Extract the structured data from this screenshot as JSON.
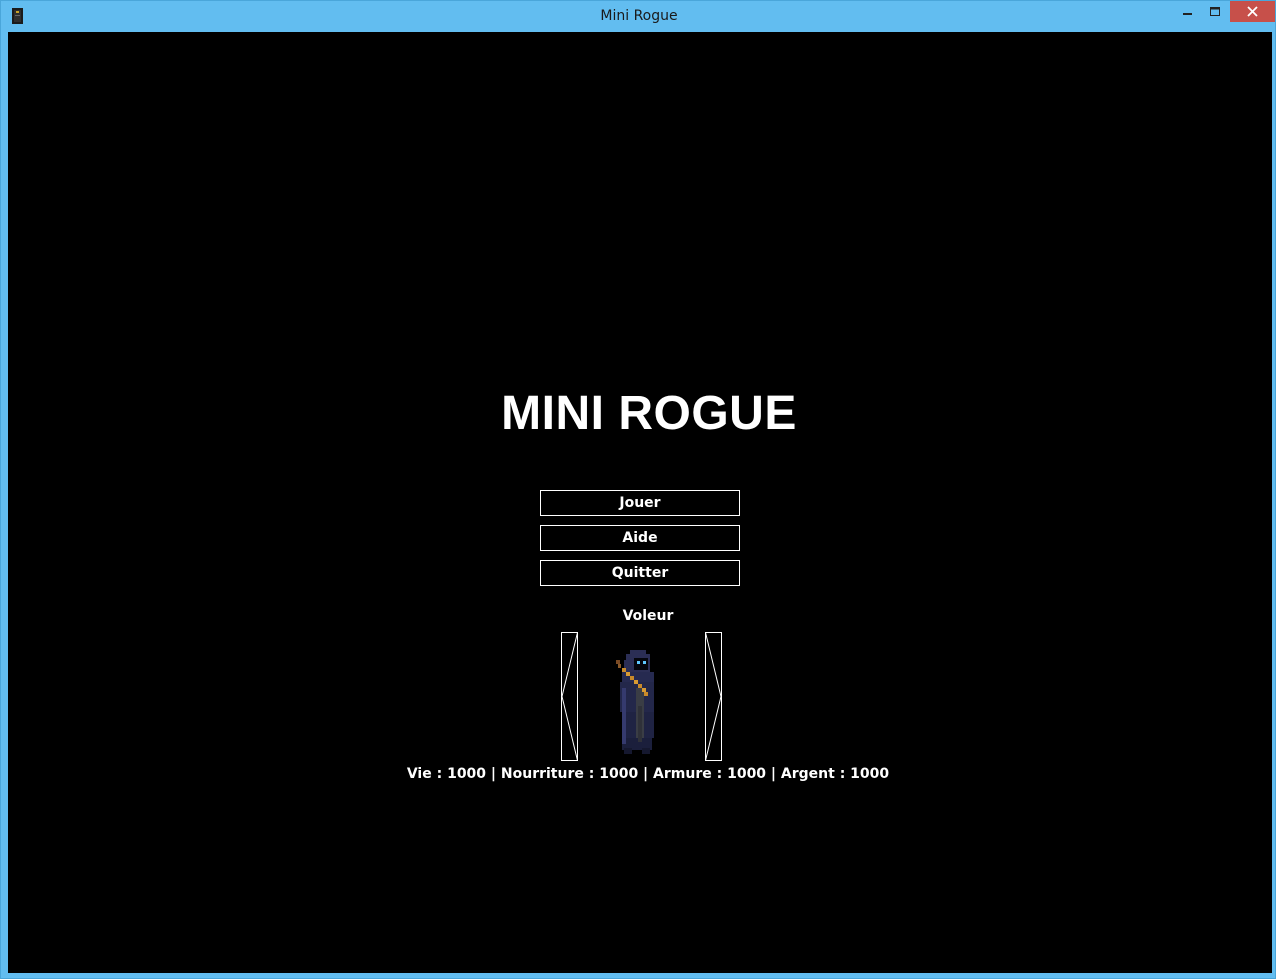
{
  "window": {
    "title": "Mini Rogue",
    "icons": [
      "app-icon",
      "minimize-icon",
      "maximize-icon",
      "close-icon"
    ]
  },
  "game": {
    "title": "MINI ROGUE",
    "menu": {
      "play_label": "Jouer",
      "help_label": "Aide",
      "quit_label": "Quitter"
    },
    "character": {
      "class_name": "Voleur",
      "sprite": "hooded-rogue-sprite",
      "stats_text": "Vie : 1000 | Nourriture : 1000 | Armure : 1000 | Argent : 1000"
    }
  },
  "colors": {
    "titlebar": "#62bdf0",
    "close_button": "#c7504a",
    "background": "#000000",
    "text": "#ffffff"
  }
}
